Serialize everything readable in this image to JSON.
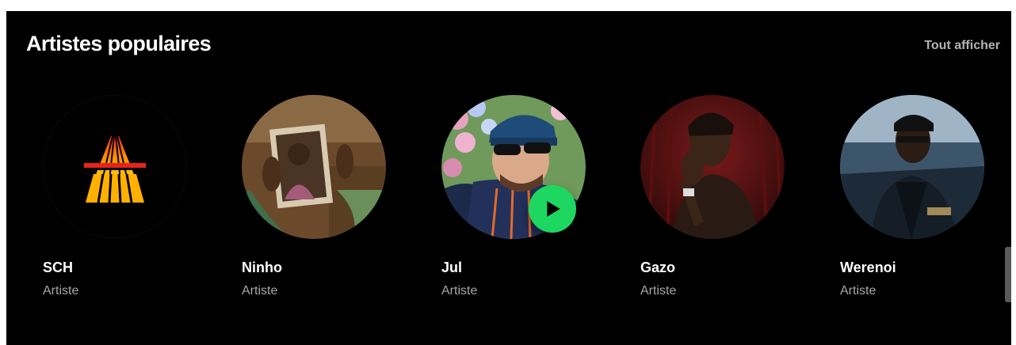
{
  "section": {
    "title": "Artistes populaires",
    "show_all_label": "Tout afficher"
  },
  "artists": [
    {
      "name": "SCH",
      "type": "Artiste",
      "icon": "sch-logo-icon"
    },
    {
      "name": "Ninho",
      "type": "Artiste"
    },
    {
      "name": "Jul",
      "type": "Artiste",
      "play_icon": "play-icon",
      "play_color": "#1ed760"
    },
    {
      "name": "Gazo",
      "type": "Artiste"
    },
    {
      "name": "Werenoi",
      "type": "Artiste"
    }
  ],
  "colors": {
    "background": "#000000",
    "text_primary": "#ffffff",
    "text_secondary": "#a7a7a7",
    "accent": "#1ed760"
  }
}
